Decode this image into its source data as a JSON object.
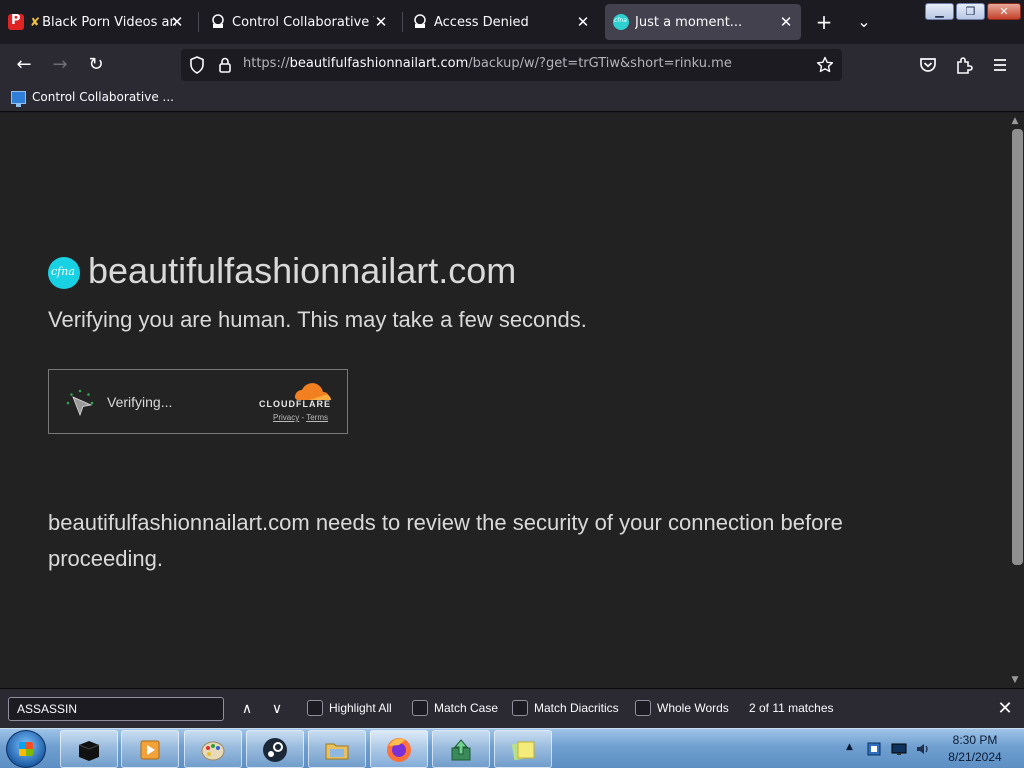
{
  "browser": {
    "tabs": [
      {
        "title": "Black Porn Videos and H",
        "active": false
      },
      {
        "title": "Control Collaborative Virtu",
        "active": false
      },
      {
        "title": "Access Denied",
        "active": false
      },
      {
        "title": "Just a moment...",
        "active": true
      }
    ],
    "tab_close_glyph": "✕",
    "new_tab_glyph": "+",
    "list_tabs_glyph": "⌄",
    "window_controls": {
      "minimize": "▁",
      "maximize": "❐",
      "close": "✕"
    },
    "nav": {
      "back": "←",
      "forward": "→",
      "reload": "↻"
    },
    "url": {
      "scheme": "https://",
      "host": "beautifulfashionnailart.com",
      "path": "/backup/w/?get=trGTiw&short=rinku.me"
    },
    "bookmark": {
      "label": "Control Collaborative ..."
    }
  },
  "page": {
    "logo_text": "cfna",
    "site_name": "beautifulfashionnailart.com",
    "subtitle": "Verifying you are human. This may take a few seconds.",
    "widget": {
      "status": "Verifying...",
      "brand": "CLOUDFLARE",
      "privacy": "Privacy",
      "separator": " - ",
      "terms": "Terms"
    },
    "security_message": "beautifulfashionnailart.com needs to review the security of your connection before proceeding."
  },
  "findbar": {
    "query": "ASSASSIN",
    "prev": "∧",
    "next": "∨",
    "options": [
      {
        "label": "Highlight All",
        "checked": false
      },
      {
        "label": "Match Case",
        "checked": false
      },
      {
        "label": "Match Diacritics",
        "checked": false
      },
      {
        "label": "Whole Words",
        "checked": false
      }
    ],
    "matches": "2 of 11 matches",
    "close": "✕"
  },
  "taskbar": {
    "time": "8:30 PM",
    "date": "8/21/2024",
    "tray_expand": "▲"
  },
  "colors": {
    "accent_cf": "#f38020",
    "logo_cyan": "#18d2e4",
    "page_bg": "#222222"
  }
}
